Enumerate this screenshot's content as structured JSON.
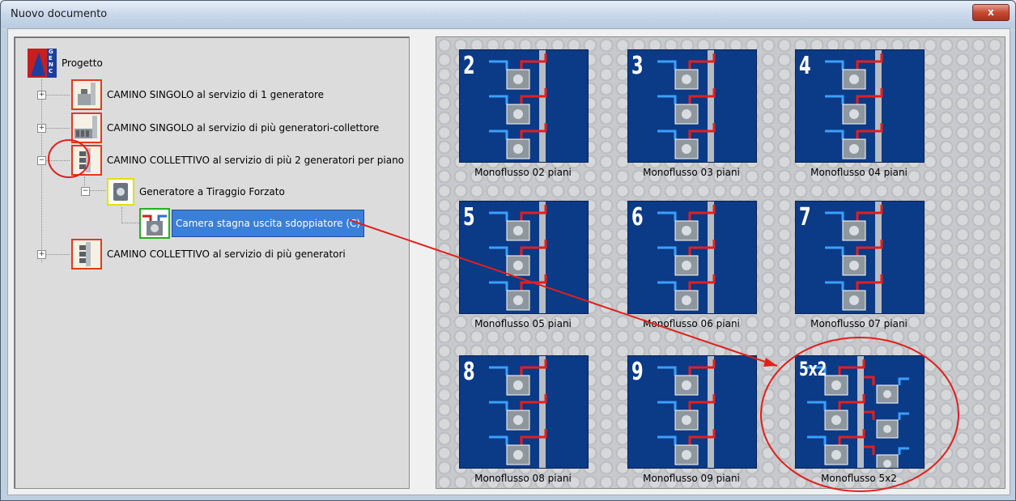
{
  "window": {
    "title": "Nuovo documento",
    "close_label": "x"
  },
  "tree": {
    "root_label": "Progetto",
    "nodes": [
      {
        "label": "CAMINO  SINGOLO al servizio di 1 generatore",
        "expander": "+"
      },
      {
        "label": "CAMINO  SINGOLO al servizio di più generatori-collettore",
        "expander": "+"
      },
      {
        "label": "CAMINO COLLETTIVO al servizio di più 2 generatori per piano",
        "expander": "−"
      },
      {
        "label": "Generatore a Tiraggio Forzato",
        "expander": "−"
      },
      {
        "label": "Camera stagna uscita sdoppiatore (C)"
      },
      {
        "label": "CAMINO COLLETTIVO al servizio di più generatori",
        "expander": "+"
      }
    ]
  },
  "gallery": {
    "items": [
      {
        "num": "2",
        "label": "Monoflusso 02 piani"
      },
      {
        "num": "3",
        "label": "Monoflusso 03 piani"
      },
      {
        "num": "4",
        "label": "Monoflusso 04 piani"
      },
      {
        "num": "5",
        "label": "Monoflusso 05 piani"
      },
      {
        "num": "6",
        "label": "Monoflusso 06 piani"
      },
      {
        "num": "7",
        "label": "Monoflusso 07 piani"
      },
      {
        "num": "8",
        "label": "Monoflusso 08 piani"
      },
      {
        "num": "9",
        "label": "Monoflusso 09 piani"
      },
      {
        "num": "5x2",
        "label": "Monoflusso 5x2"
      }
    ]
  },
  "logo": {
    "letters": "GENC"
  },
  "colors": {
    "thumb_bg": "#0b3a86",
    "selection": "#3a7fd8",
    "annotation": "#e0201a"
  }
}
